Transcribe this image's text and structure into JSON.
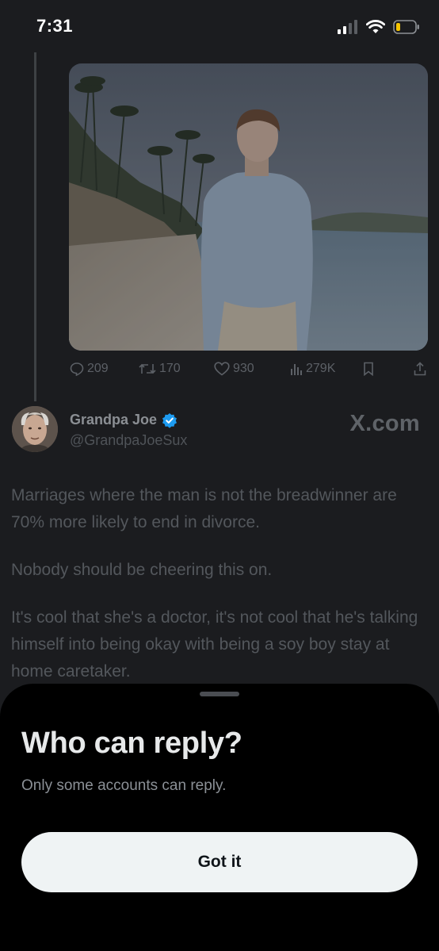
{
  "status_bar": {
    "time": "7:31",
    "icons": [
      "cellular-signal-icon",
      "wifi-icon",
      "battery-low-icon"
    ]
  },
  "previous_tweet": {
    "photo_alt": "man-on-beach-photo",
    "actions": {
      "replies": "209",
      "retweets": "170",
      "likes": "930",
      "views": "279K"
    }
  },
  "tweet": {
    "author": {
      "name": "Grandpa Joe",
      "handle": "@GrandpaJoeSux",
      "verified": true
    },
    "watermark": "X.com",
    "paragraphs": [
      "Marriages where the man is not the breadwinner are 70% more likely to end in divorce.",
      "Nobody should be cheering this on.",
      "It's cool that she's a doctor, it's not cool that he's talking himself into being okay with being a soy boy stay at home caretaker."
    ]
  },
  "sheet": {
    "title": "Who can reply?",
    "subtitle": "Only some accounts can reply.",
    "button_label": "Got it"
  },
  "colors": {
    "background": "#1b1c1f",
    "sheet_background": "#000000",
    "button_background": "#eff3f4",
    "verified_blue": "#1d9bf0",
    "battery_fill": "#f5c400"
  }
}
